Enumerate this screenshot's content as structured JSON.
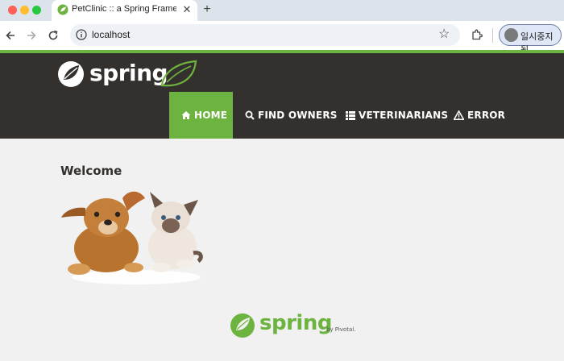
{
  "browser": {
    "tab_title": "PetClinic :: a Spring Framewo",
    "tab_close": "✕",
    "new_tab": "+",
    "url": "localhost",
    "profile_label": "일시중지됨"
  },
  "header": {
    "logo_text": "spring"
  },
  "nav": {
    "items": [
      {
        "label": "HOME",
        "icon": "home-icon"
      },
      {
        "label": "FIND OWNERS",
        "icon": "search-icon"
      },
      {
        "label": "VETERINARIANS",
        "icon": "list-icon"
      },
      {
        "label": "ERROR",
        "icon": "warning-icon"
      }
    ],
    "active": "HOME",
    "active_color": "#6db33f"
  },
  "main": {
    "heading": "Welcome",
    "image": "puppy-and-kitten"
  },
  "footer": {
    "logo_text": "spring",
    "by": "by Pivotal."
  },
  "colors": {
    "brand_green": "#6db33f",
    "navbar_bg": "#34302d",
    "page_bg": "#f1f1f1"
  }
}
